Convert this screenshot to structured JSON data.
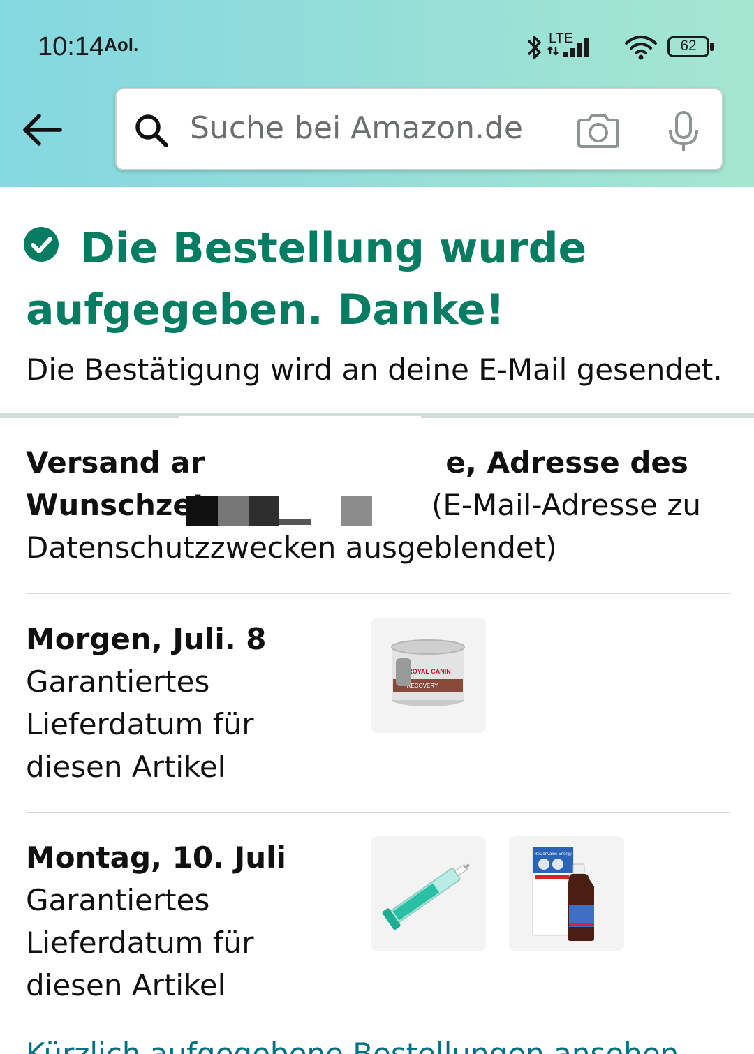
{
  "status_bar": {
    "time": "10:14",
    "carrier_badge": "Aol.",
    "network": "LTE",
    "battery": "62"
  },
  "header": {
    "search": {
      "placeholder": "Suche bei Amazon.de"
    }
  },
  "confirmation": {
    "title": "Die Bestellung wurde aufgegeben. Danke!",
    "subtitle": "Die Bestätigung wird an deine E-Mail gesendet.",
    "accent_color": "#067d62"
  },
  "shipping": {
    "label_start": "Versand ar",
    "label_mid": "e, Adresse des",
    "label_line2_start": "Wunschzet",
    "hidden_note": "(E-Mail-Adresse zu Datenschutzzwecken ausgeblendet)"
  },
  "deliveries": [
    {
      "date": "Morgen, Juli. 8",
      "note": "Garantiertes Lieferdatum für diesen Artikel",
      "items": [
        {
          "icon": "cat-food-can-image",
          "label": "ROYAL CANIN",
          "sublabel": "RECOVERY"
        }
      ]
    },
    {
      "date": "Montag, 10. Juli",
      "note": "Garantiertes Lieferdatum für diesen Artikel",
      "items": [
        {
          "icon": "syringe-image"
        },
        {
          "icon": "reconvales-bottle-image",
          "label": "ReConvales Energy"
        }
      ]
    }
  ],
  "links": {
    "recent_orders": "Kürzlich aufgegebene Bestellungen ansehen"
  }
}
